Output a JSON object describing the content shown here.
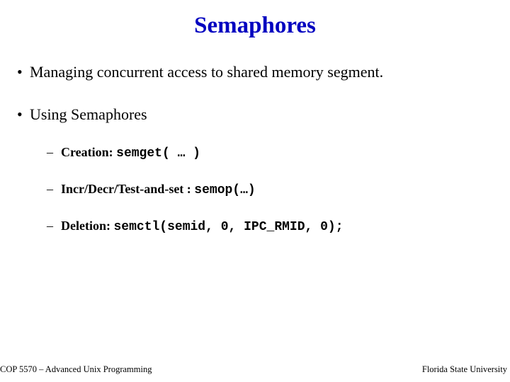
{
  "title": "Semaphores",
  "bullets": {
    "b1": "Managing concurrent access to shared memory segment.",
    "b2": "Using Semaphores",
    "sub1_label": "Creation:  ",
    "sub1_code": "semget( … )",
    "sub2_label": "Incr/Decr/Test-and-set : ",
    "sub2_code": "semop(…)",
    "sub3_label": "Deletion: ",
    "sub3_code": "semctl(semid, 0, IPC_RMID, 0);"
  },
  "footer": {
    "left": "COP 5570 – Advanced Unix Programming",
    "right": "Florida State University"
  }
}
